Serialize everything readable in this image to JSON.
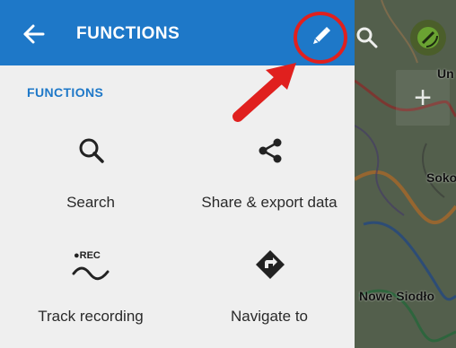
{
  "appbar": {
    "title": "FUNCTIONS",
    "bg": "#1e78c8"
  },
  "panel": {
    "section_title": "FUNCTIONS",
    "items": [
      {
        "label": "Search",
        "icon": "search-icon"
      },
      {
        "label": "Share & export data",
        "icon": "share-icon"
      },
      {
        "label": "Track recording",
        "icon": "track-recording-icon"
      },
      {
        "label": "Navigate to",
        "icon": "navigate-icon"
      }
    ],
    "track_icon_text": "●REC"
  },
  "map": {
    "labels": [
      "Un",
      "Soko",
      "Nowe Siodło"
    ]
  },
  "annotation": {
    "color": "#e0201e"
  }
}
